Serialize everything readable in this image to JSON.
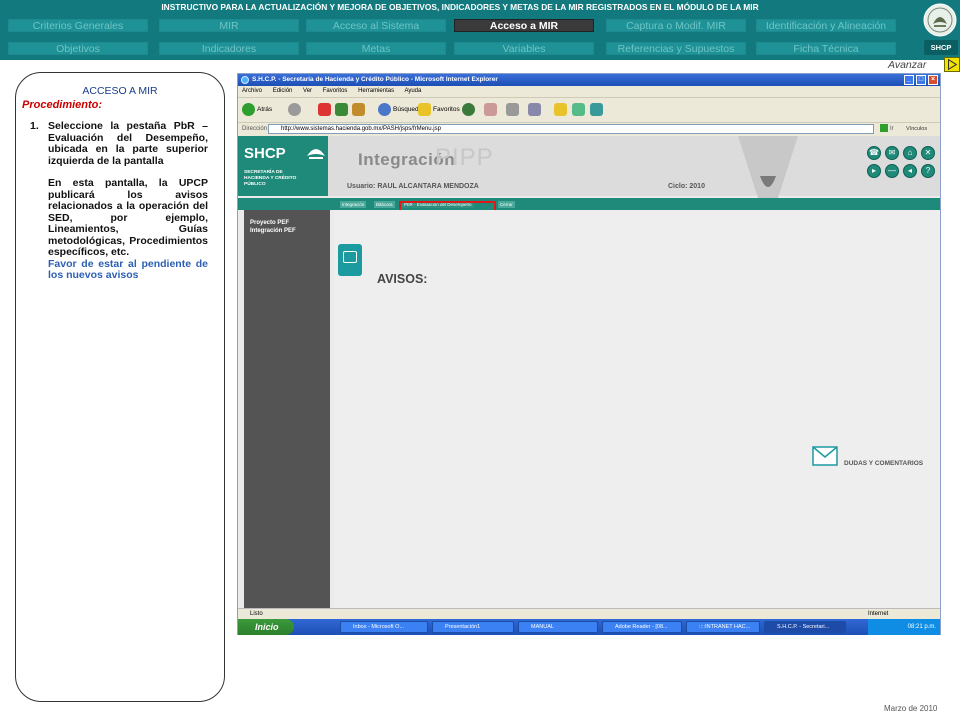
{
  "header": {
    "title": "INSTRUCTIVO PARA  LA ACTUALIZACIÓN Y MEJORA DE OBJETIVOS, INDICADORES Y METAS DE LA MIR REGISTRADOS EN EL MÓDULO DE LA MIR",
    "nav_row1": [
      "Criterios Generales",
      "MIR",
      "Acceso al Sistema",
      "Acceso a MIR",
      "Captura o Modif. MIR",
      "Identificación y Alineación"
    ],
    "nav_row2": [
      "Objetivos",
      "Indicadores",
      "Metas",
      "Variables",
      "Referencias y Supuestos",
      "Ficha Técnica"
    ],
    "active_nav": "Acceso a MIR",
    "brand": "SHCP"
  },
  "avanzar": "Avanzar",
  "left_panel": {
    "title": "ACCESO A MIR",
    "procedure_label": "Procedimiento:",
    "step_number": "1.",
    "step_text": "Seleccione la pestaña PbR – Evaluación del Desempeño, ubicada en la parte superior izquierda de la pantalla",
    "paragraph": "En esta pantalla, la UPCP publicará los avisos relacionados a la operación del SED, por ejemplo, Lineamientos, Guías metodológicas, Procedimientos específicos, etc.",
    "highlight": "Favor de estar al pendiente de los nuevos avisos"
  },
  "browser": {
    "window_title": "S.H.C.P. - Secretaría de Hacienda y Crédito Público - Microsoft Internet Explorer",
    "menu": [
      "Archivo",
      "Edición",
      "Ver",
      "Favoritos",
      "Herramientas",
      "Ayuda"
    ],
    "toolbar": {
      "back": "Atrás",
      "search": "Búsqueda",
      "favorites": "Favoritos"
    },
    "address_label": "Dirección",
    "address_url": "http://www.sistemas.hacienda.gob.mx/PASH/jsps/frMenu.jsp",
    "go": "Ir",
    "links": "Vínculos",
    "status_left": "Listo",
    "status_right": "Internet"
  },
  "app": {
    "logo_big": "SHCP",
    "logo_small": "SECRETARÍA DE HACIENDA Y CRÉDITO PÚBLICO",
    "integration_title": "Integración",
    "pipp": "PIPP",
    "user": "Usuario: RAUL ALCANTARA MENDOZA",
    "cycle": "Ciclo: 2010",
    "tabs": [
      "Integración",
      "Bitácora",
      "PbR - Evaluación del Desempeño",
      "Cerrar"
    ],
    "sidebar_items": [
      "Proyecto PEF",
      "Integración PEF"
    ],
    "avisos": "AVISOS:",
    "dudas": "DUDAS Y COMENTARIOS"
  },
  "taskbar": {
    "start": "Inicio",
    "tasks": [
      "Inbox - Microsoft O...",
      "Presentación1",
      "MANUAL",
      "Adobe Reader - [08...",
      "::::INTRANET HAC...",
      "S.H.C.P. - Secretari..."
    ],
    "clock": "08:21 p.m."
  },
  "footer_date": "Marzo de 2010",
  "colors": {
    "teal": "#127a7e",
    "app_green": "#1f8a79",
    "highlight_red": "#e01818"
  }
}
